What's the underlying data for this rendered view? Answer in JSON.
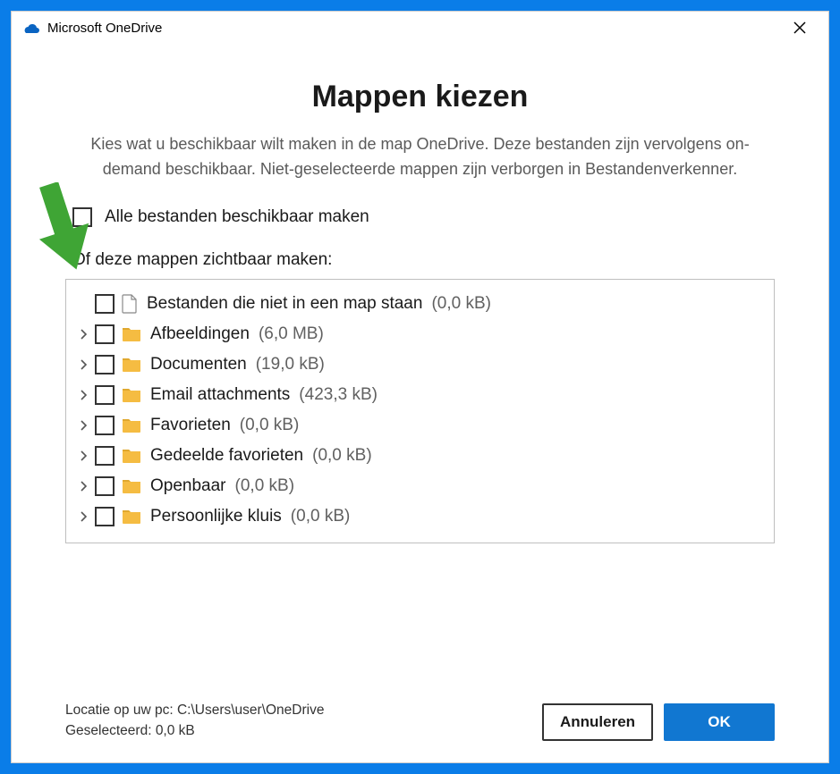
{
  "titlebar": {
    "title": "Microsoft OneDrive"
  },
  "page": {
    "heading": "Mappen kiezen",
    "description": "Kies wat u beschikbaar wilt maken in de map OneDrive. Deze bestanden zijn vervolgens on-demand beschikbaar. Niet-geselecteerde mappen zijn verborgen in Bestandenverkenner."
  },
  "masterCheck": {
    "label": "Alle bestanden beschikbaar maken"
  },
  "subheading": "Of deze mappen zichtbaar maken:",
  "folders": [
    {
      "expandable": false,
      "iconType": "file",
      "name": "Bestanden die niet in een map staan",
      "size": "(0,0 kB)"
    },
    {
      "expandable": true,
      "iconType": "folder",
      "name": "Afbeeldingen",
      "size": "(6,0 MB)"
    },
    {
      "expandable": true,
      "iconType": "folder",
      "name": "Documenten",
      "size": "(19,0 kB)"
    },
    {
      "expandable": true,
      "iconType": "folder",
      "name": "Email attachments",
      "size": "(423,3 kB)"
    },
    {
      "expandable": true,
      "iconType": "folder",
      "name": "Favorieten",
      "size": "(0,0 kB)"
    },
    {
      "expandable": true,
      "iconType": "folder",
      "name": "Gedeelde favorieten",
      "size": "(0,0 kB)"
    },
    {
      "expandable": true,
      "iconType": "folder",
      "name": "Openbaar",
      "size": "(0,0 kB)"
    },
    {
      "expandable": true,
      "iconType": "folder",
      "name": "Persoonlijke kluis",
      "size": "(0,0 kB)"
    }
  ],
  "footer": {
    "locationLabel": "Locatie op uw pc: ",
    "locationPath": "C:\\Users\\user\\OneDrive",
    "selectedLabel": "Geselecteerd: ",
    "selectedValue": "0,0 kB",
    "cancel": "Annuleren",
    "ok": "OK"
  },
  "colors": {
    "accent": "#1177d1",
    "folder": "#f5bc42",
    "arrow": "#3fa535"
  }
}
